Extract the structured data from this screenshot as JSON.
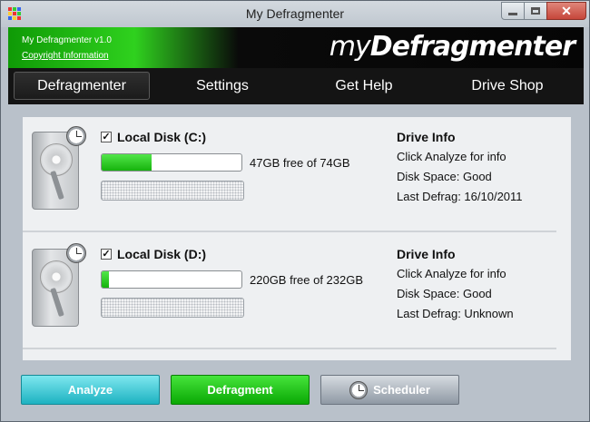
{
  "window": {
    "title": "My Defragmenter",
    "close_glyph": "✕"
  },
  "banner": {
    "version": "My Defragmenter v1.0",
    "copyright_link": "Copyright Information",
    "logo_thin": "my",
    "logo_bold": "Defragmenter"
  },
  "nav": {
    "items": [
      {
        "label": "Defragmenter",
        "active": true
      },
      {
        "label": "Settings",
        "active": false
      },
      {
        "label": "Get Help",
        "active": false
      },
      {
        "label": "Drive Shop",
        "active": false
      }
    ]
  },
  "drives": [
    {
      "label": "Local Disk (C:)",
      "checked": true,
      "free_text": "47GB free of 74GB",
      "used_fraction": 0.36,
      "info_title": "Drive Info",
      "info_status": "Click Analyze for info",
      "disk_space": "Disk Space: Good",
      "last_defrag": "Last Defrag: 16/10/2011"
    },
    {
      "label": "Local Disk (D:)",
      "checked": true,
      "free_text": "220GB free of 232GB",
      "used_fraction": 0.05,
      "info_title": "Drive Info",
      "info_status": "Click Analyze for info",
      "disk_space": "Disk Space: Good",
      "last_defrag": "Last Defrag: Unknown"
    }
  ],
  "actions": {
    "analyze": "Analyze",
    "defragment": "Defragment",
    "scheduler": "Scheduler"
  },
  "colors": {
    "accent_green": "#16b30d",
    "analyze_cyan": "#1db2c1",
    "nav_black": "#141414"
  }
}
